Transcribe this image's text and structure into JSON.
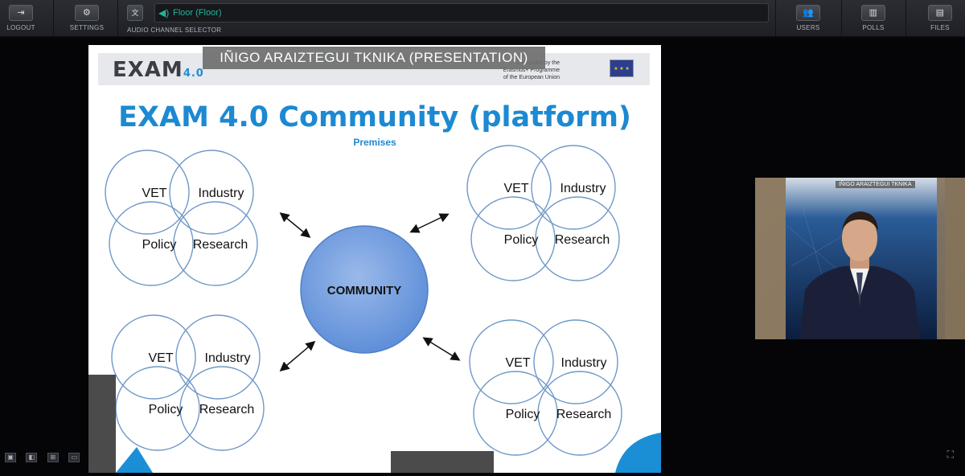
{
  "toolbar": {
    "logout_label": "LOGOUT",
    "settings_label": "SETTINGS",
    "audio_selector_label": "AUDIO CHANNEL SELECTOR",
    "audio_channel_value": "Floor (Floor)",
    "users_label": "USERS",
    "polls_label": "POLLS",
    "files_label": "FILES",
    "accent_color": "#23b39a"
  },
  "presentation": {
    "presenter_label": "IÑIGO ARAIZTEGUI TKNIKA (PRESENTATION)",
    "slide": {
      "logo_text": "EXAM",
      "logo_version": "4.0",
      "cofunded_line1": "Co-funded by the",
      "cofunded_line2": "Erasmus+ Programme",
      "cofunded_line3": "of the European Union",
      "title": "EXAM 4.0 Community (platform)",
      "subtitle": "Premises",
      "center_label": "COMMUNITY",
      "title_color": "#1c89d2",
      "groups": [
        {
          "vet": "VET",
          "industry": "Industry",
          "policy": "Policy",
          "research": "Research"
        },
        {
          "vet": "VET",
          "industry": "Industry",
          "policy": "Policy",
          "research": "Research"
        },
        {
          "vet": "VET",
          "industry": "Industry",
          "policy": "Policy",
          "research": "Research"
        },
        {
          "vet": "VET",
          "industry": "Industry",
          "policy": "Policy",
          "research": "Research"
        }
      ]
    }
  },
  "webcam": {
    "name_tag": "IÑIGO ARAIZTEGUI TKNIKA"
  }
}
